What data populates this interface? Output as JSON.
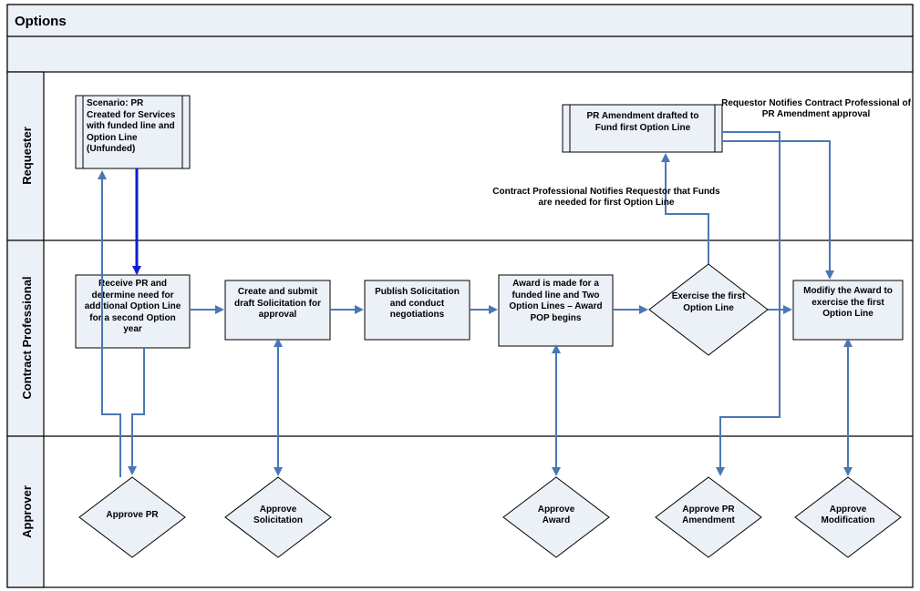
{
  "title": "Options",
  "lanes": {
    "requester": "Requester",
    "contract_professional": "Contract Professional",
    "approver": "Approver"
  },
  "requester": {
    "scenario": "Scenario:  PR Created for Services with funded line and Option Line (Unfunded)",
    "pr_amendment": "PR Amendment drafted to Fund first Option Line"
  },
  "contract": {
    "receive_pr": "Receive PR and determine need for additional Option Line for a second Option year",
    "create_solicitation": "Create and submit draft Solicitation for approval",
    "publish": "Publish Solicitation and conduct negotiations",
    "award": "Award is made for a funded line and Two Option Lines – Award POP begins",
    "exercise": "Exercise the first Option Line",
    "modify": "Modifiy the Award to exercise the first Option Line"
  },
  "approver": {
    "approve_pr": "Approve PR",
    "approve_solicitation": "Approve Solicitation",
    "approve_award": "Approve Award",
    "approve_pr_amendment": "Approve PR Amendment",
    "approve_modification": "Approve Modification"
  },
  "notes": {
    "contract_notifies": "Contract Professional Notifies Requestor that Funds are needed for first Option Line",
    "requestor_notifies": "Requestor Notifies Contract Professional of PR Amendment approval"
  }
}
